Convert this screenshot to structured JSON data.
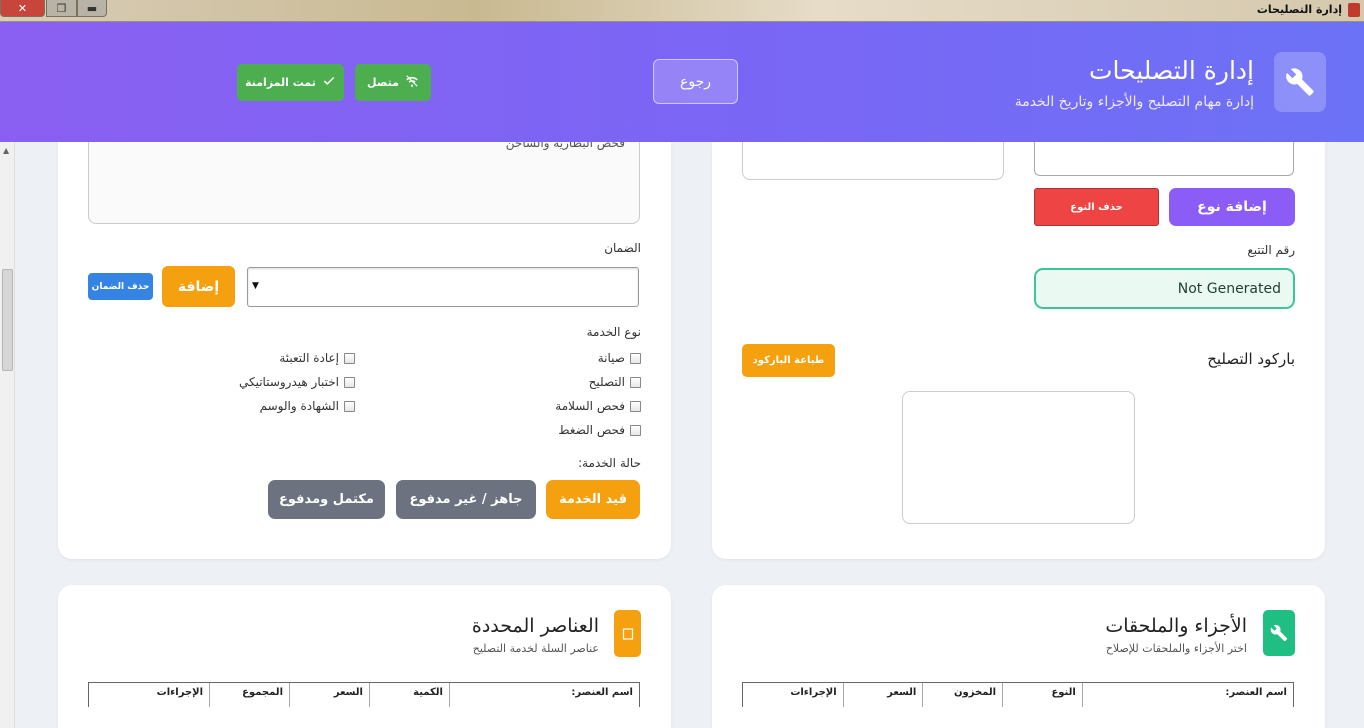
{
  "window": {
    "title": "إدارة التصليحات",
    "controls": [
      "close-icon",
      "maximize-icon",
      "minimize-icon"
    ]
  },
  "header": {
    "title": "إدارة التصليحات",
    "subtitle": "إدارة مهام التصليح والأجزاء وتاريخ الخدمة",
    "icon": "wrench-icon",
    "back_label": "رجوع",
    "online_label": "متصل",
    "sync_label": "تمت المزامنة",
    "online_icon": "wifi-off-icon",
    "sync_icon": "check-icon"
  },
  "left_panel": {
    "notes_text": "فحص البطارية والشاحن",
    "warranty_label": "الضمان",
    "warranty_value": "",
    "add_warranty_label": "إضافة",
    "delete_warranty_label": "حذف الضمان",
    "service_type_label": "نوع الخدمة",
    "service_types_col1": [
      "صيانة",
      "التصليح",
      "فحص السلامة",
      "فحص الضغط"
    ],
    "service_types_col2": [
      "إعادة التعبئة",
      "اختبار هيدروستاتيكي",
      "الشهادة والوسم"
    ],
    "service_status_label": "حالة الخدمة:",
    "status_pending": "قيد الخدمة",
    "status_ready_unpaid": "جاهز / غير مدفوع",
    "status_completed_paid": "مكتمل ومدفوع"
  },
  "right_panel": {
    "add_type_label": "إضافة نوع",
    "delete_type_label": "حذف النوع",
    "tracking_label": "رقم التتبع",
    "tracking_value": "Not Generated",
    "barcode_label": "باركود التصليح",
    "print_barcode_label": "طباعة الباركود"
  },
  "parts_section": {
    "title": "الأجزاء والملحقات",
    "subtitle": "اختر الأجزاء والملحقات للإصلاح",
    "icon": "wrench-icon",
    "columns": [
      "اسم العنصر:",
      "النوع",
      "المخزون",
      "السعر",
      "الإجراءات"
    ]
  },
  "selected_section": {
    "title": "العناصر المحددة",
    "subtitle": "عناصر السلة لخدمة التصليح",
    "icon": "cart-icon",
    "columns": [
      "اسم العنصر:",
      "الكمية",
      "السعر",
      "المجموع",
      "الإجراءات"
    ]
  },
  "colors": {
    "header_start": "#8a60f2",
    "header_end": "#6c72f6",
    "green": "#4cae4f",
    "orange": "#f5a00e",
    "purple": "#8b5cf6",
    "red": "#ef4444",
    "blue": "#3584e4",
    "gray": "#6c727f",
    "teal": "#3cc49a"
  }
}
